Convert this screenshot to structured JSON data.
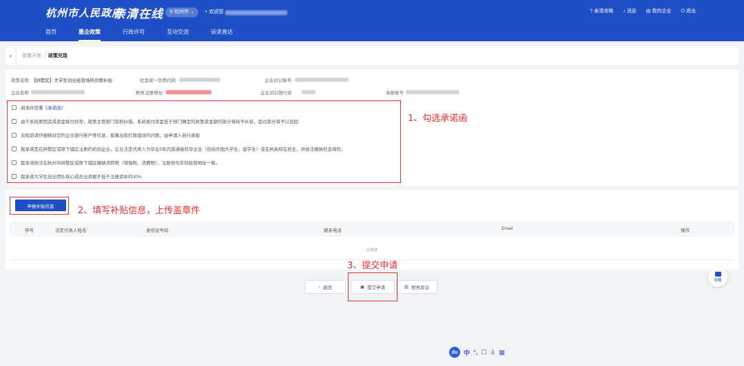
{
  "header": {
    "logo": "杭州市人民政府",
    "slogan": "亲清在线",
    "city": "杭州市",
    "welcome": "欢迎您",
    "right_items": [
      {
        "icon": "question-circle-icon",
        "label": "亲清攻略"
      },
      {
        "icon": "bell-icon",
        "label": "消息"
      },
      {
        "icon": "building-icon",
        "label": "我的企业"
      },
      {
        "icon": "power-icon",
        "label": "退出"
      }
    ],
    "nav": [
      "首页",
      "惠企政策",
      "行政许可",
      "互动交流",
      "诉求直达"
    ],
    "nav_active_index": 1
  },
  "breadcrumb": {
    "root": "政策天地",
    "separator": "/",
    "current": "政策兑现"
  },
  "info": {
    "policy_name_label": "政策名称:",
    "policy_name_value": "【拱墅区】大学生创业经营场所房租补贴",
    "credit_code_label": "社会统一信用代码:",
    "account_no_label": "企业对公账号:",
    "company_label": "企业名称",
    "tax_address_label": "税务注册地址:",
    "bank_label": "企业对公银行支",
    "receive_account_label": "收款账号"
  },
  "checklist": [
    {
      "prefix": "阅读并签署",
      "link": "《承诺函》",
      "suffix": ""
    },
    {
      "prefix": "由于系统原因造成资金拨付异常，政策主管部门有权纠错，系统拨付资金低于部门确定的政策资金额的部分将给予补足，超过部分将予以追回",
      "link": "",
      "suffix": ""
    },
    {
      "prefix": "兑现前请仔细核对您的企业银行账户等信息，如果出现打款错误的问题，由申请人自行承担",
      "link": "",
      "suffix": ""
    },
    {
      "prefix": "我承诺是在拱墅区或原下城区注册的初创企业，企业法定代表人为毕业5年内普通高校毕业生（包括外国大学生、留学生）或在杭高校在校生，并依法缴纳社会保险。",
      "link": "",
      "suffix": ""
    },
    {
      "prefix": "我承诺依法在杭州市拱墅区或原下城区缴纳流转税（增值税、消费税），注册地与实际经营地址一致。",
      "link": "",
      "suffix": ""
    },
    {
      "prefix": "我承诺大学生创业团队核心成员出资额不低于注册资本的30%",
      "link": "",
      "suffix": ""
    }
  ],
  "annotations": {
    "step1": "1、勾选承诺函",
    "step2": "2、填写补贴信息，上传盖章件",
    "step3": "3、提交申请"
  },
  "apply_button": "申报补贴信息",
  "table": {
    "headers": [
      "序号",
      "法定代表人姓名",
      "身份证号码",
      "联系电话",
      "Email",
      "操作"
    ],
    "empty_text": "无数据"
  },
  "buttons": {
    "back": "返回",
    "submit": "提交申请",
    "tax_dispute": "税务异议"
  },
  "float_button": "攻略",
  "ime": {
    "logo": "du",
    "items": [
      "中",
      "°,",
      "☐",
      "♙",
      "▦"
    ]
  }
}
